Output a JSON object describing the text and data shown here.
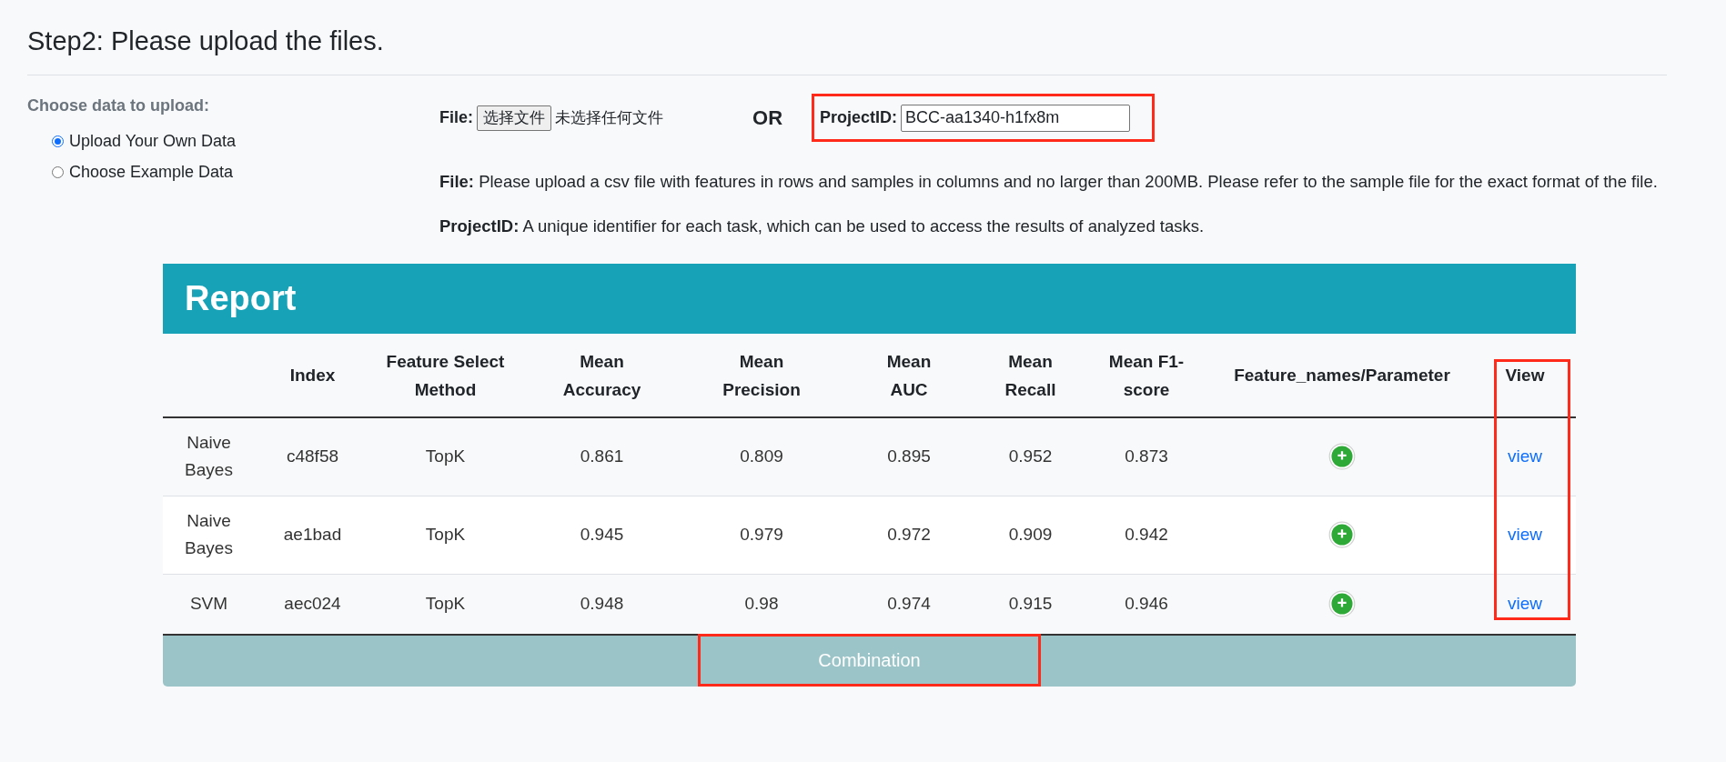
{
  "heading": "Step2: Please upload the files.",
  "source": {
    "label": "Choose data to upload:",
    "options": [
      {
        "label": "Upload Your Own Data",
        "selected": true
      },
      {
        "label": "Choose Example Data",
        "selected": false
      }
    ]
  },
  "file": {
    "label": "File:",
    "button": "选择文件",
    "status": "未选择任何文件"
  },
  "or": "OR",
  "project": {
    "label": "ProjectID:",
    "value": "BCC-aa1340-h1fx8m",
    "highlighted": true
  },
  "notes": [
    {
      "term": "File:",
      "text": "Please upload a csv file with features in rows and samples in columns and no larger than 200MB. Please refer to the sample file for the exact format of the file."
    },
    {
      "term": "ProjectID:",
      "text": "A unique identifier for each task, which can be used to access the results of analyzed tasks."
    }
  ],
  "report": {
    "title": "Report",
    "columns": [
      {
        "label": "Index"
      },
      {
        "label": "Feature Select Method"
      },
      {
        "label": "Mean Accuracy"
      },
      {
        "label": "Mean Precision"
      },
      {
        "label": "Mean AUC"
      },
      {
        "label": "Mean Recall"
      },
      {
        "label": "Mean F1-score"
      },
      {
        "label": "Feature_names/Parameter"
      },
      {
        "label": "View",
        "highlighted": true
      }
    ],
    "rows": [
      {
        "model": "Naive Bayes",
        "index": "c48f58",
        "method": "TopK",
        "accuracy": "0.861",
        "precision": "0.809",
        "auc": "0.895",
        "recall": "0.952",
        "f1": "0.873",
        "link": "view"
      },
      {
        "model": "Naive Bayes",
        "index": "ae1bad",
        "method": "TopK",
        "accuracy": "0.945",
        "precision": "0.979",
        "auc": "0.972",
        "recall": "0.909",
        "f1": "0.942",
        "link": "view"
      },
      {
        "model": "SVM",
        "index": "aec024",
        "method": "TopK",
        "accuracy": "0.948",
        "precision": "0.98",
        "auc": "0.974",
        "recall": "0.915",
        "f1": "0.946",
        "link": "view"
      }
    ],
    "combination": {
      "label": "Combination",
      "highlighted": true
    }
  }
}
